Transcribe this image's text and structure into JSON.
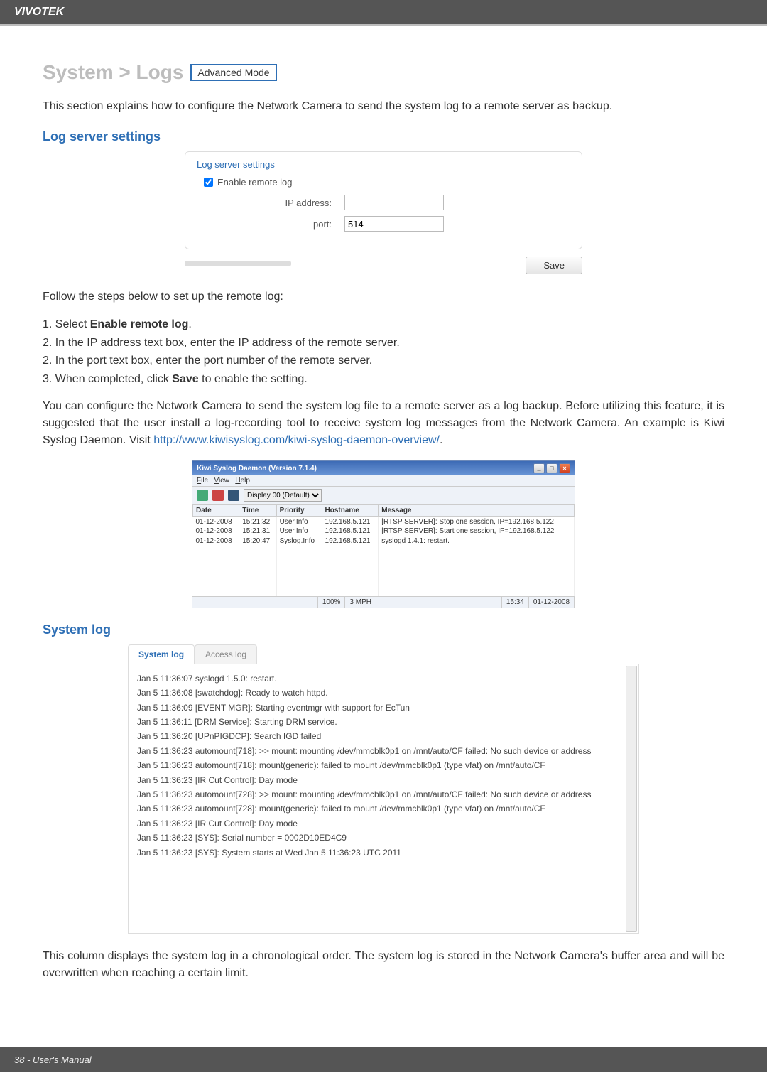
{
  "brand": "VIVOTEK",
  "breadcrumb": "System > Logs",
  "mode_badge": "Advanced Mode",
  "intro": "This section explains how to configure the Network Camera to send the system log to a remote server as backup.",
  "section_log_server": "Log server settings",
  "panel": {
    "title": "Log server settings",
    "enable_label": "Enable remote log",
    "ip_label": "IP address:",
    "ip_value": "",
    "port_label": "port:",
    "port_value": "514",
    "save_label": "Save"
  },
  "follow_steps": "Follow the steps below to set up the remote log:",
  "steps": [
    {
      "n": "1.",
      "pre": "Select ",
      "bold": "Enable remote log",
      "post": "."
    },
    {
      "n": "2.",
      "pre": "In the IP address text box, enter the IP address of the remote server.",
      "bold": "",
      "post": ""
    },
    {
      "n": "2.",
      "pre": "In the port text box, enter the port number of the remote server.",
      "bold": "",
      "post": ""
    },
    {
      "n": "3.",
      "pre": "When completed, click ",
      "bold": "Save",
      "post": " to enable the setting."
    }
  ],
  "remote_desc_1": "You can configure the Network Camera to send the system log file to a remote server as a log backup. Before utilizing this feature, it is suggested that the user install a log-recording tool to receive system log messages from the Network Camera. An example is Kiwi Syslog Daemon. Visit ",
  "remote_link": "http://www.kiwisyslog.com/kiwi-syslog-daemon-overview/",
  "remote_desc_2": ".",
  "kiwi": {
    "title": "Kiwi Syslog Daemon (Version 7.1.4)",
    "menu": {
      "file": "File",
      "view": "View",
      "help": "Help"
    },
    "display_label": "Display 00 (Default)",
    "headers": [
      "Date",
      "Time",
      "Priority",
      "Hostname",
      "Message"
    ],
    "rows": [
      [
        "01-12-2008",
        "15:21:32",
        "User.Info",
        "192.168.5.121",
        "[RTSP SERVER]: Stop one session, IP=192.168.5.122"
      ],
      [
        "01-12-2008",
        "15:21:31",
        "User.Info",
        "192.168.5.121",
        "[RTSP SERVER]: Start one session, IP=192.168.5.122"
      ],
      [
        "01-12-2008",
        "15:20:47",
        "Syslog.Info",
        "192.168.5.121",
        "syslogd 1.4.1: restart."
      ]
    ],
    "status_pct": "100%",
    "status_mph": "3 MPH",
    "status_time": "15:34",
    "status_date": "01-12-2008"
  },
  "section_system_log": "System log",
  "tabs": {
    "system": "System log",
    "access": "Access log"
  },
  "log_entries": [
    "Jan 5 11:36:07 syslogd 1.5.0: restart.",
    "Jan 5 11:36:08 [swatchdog]: Ready to watch httpd.",
    "Jan 5 11:36:09 [EVENT MGR]: Starting eventmgr with support for EcTun",
    "Jan 5 11:36:11 [DRM Service]: Starting DRM service.",
    "Jan 5 11:36:20 [UPnPIGDCP]: Search IGD failed",
    "Jan 5 11:36:23 automount[718]: >> mount: mounting /dev/mmcblk0p1 on /mnt/auto/CF failed: No such device or address",
    "Jan 5 11:36:23 automount[718]: mount(generic): failed to mount /dev/mmcblk0p1 (type vfat) on /mnt/auto/CF",
    "Jan 5 11:36:23 [IR Cut Control]: Day mode",
    "Jan 5 11:36:23 automount[728]: >> mount: mounting /dev/mmcblk0p1 on /mnt/auto/CF failed: No such device or address",
    "Jan 5 11:36:23 automount[728]: mount(generic): failed to mount /dev/mmcblk0p1 (type vfat) on /mnt/auto/CF",
    "Jan 5 11:36:23 [IR Cut Control]: Day mode",
    "Jan 5 11:36:23 [SYS]: Serial number = 0002D10ED4C9",
    "Jan 5 11:36:23 [SYS]: System starts at Wed Jan 5 11:36:23 UTC 2011"
  ],
  "system_log_desc": "This column displays the system log in a chronological order. The system log is stored in the Network Camera's buffer area and will be overwritten when reaching a certain limit.",
  "footer": "38 - User's Manual"
}
